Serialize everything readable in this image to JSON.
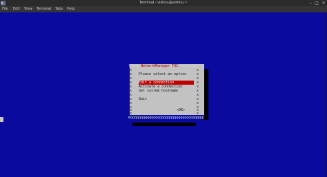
{
  "window": {
    "title": "Terminal - vishnu@vishnu:~"
  },
  "menubar": {
    "items": [
      "File",
      "Edit",
      "View",
      "Terminal",
      "Tabs",
      "Help"
    ]
  },
  "dialog": {
    "title_left": "lqqqu",
    "title": "NetworkManager TUI",
    "title_right": "tqqqqqqk",
    "border_char": "x",
    "rows": [
      {
        "text": ""
      },
      {
        "text": "Please select an option"
      },
      {
        "text": ""
      },
      {
        "text": "Edit a connection",
        "selected": true
      },
      {
        "text": "Activate a connection"
      },
      {
        "text": "Set system hostname"
      },
      {
        "text": ""
      },
      {
        "text": "Quit"
      },
      {
        "text": ""
      },
      {
        "text": ""
      },
      {
        "text": "<OK>"
      },
      {
        "text": ""
      }
    ],
    "bottom_border": "mqqqqqqqqqqqqqqqqqqqqqqqqqqqqqqqqqqqqqqqj"
  },
  "colors": {
    "terminal_bg": "#0a0a9e",
    "dialog_bg": "#c2c2c2",
    "selection": "#c00000",
    "titlebar_bg": "#2b2b2b",
    "menubar_bg": "#353535"
  },
  "icons": [
    "terminal-app-icon",
    "minimize-icon",
    "maximize-icon",
    "close-icon"
  ]
}
